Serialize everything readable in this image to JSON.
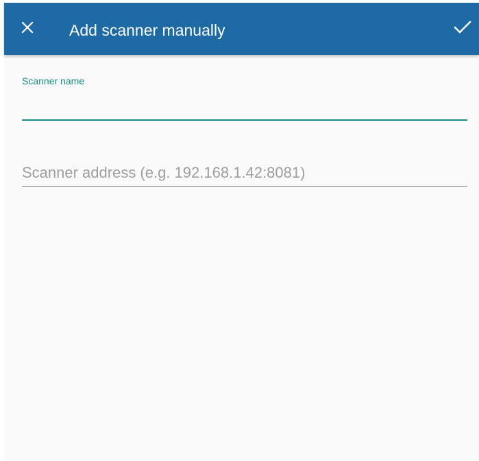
{
  "appbar": {
    "title": "Add scanner manually",
    "close_icon": "close-icon",
    "confirm_icon": "check-icon",
    "background_color": "#1e6aa5"
  },
  "form": {
    "scanner_name": {
      "label": "Scanner name",
      "value": "",
      "accent_color": "#1b8a82"
    },
    "scanner_address": {
      "placeholder": "Scanner address (e.g. 192.168.1.42:8081)",
      "value": ""
    }
  }
}
